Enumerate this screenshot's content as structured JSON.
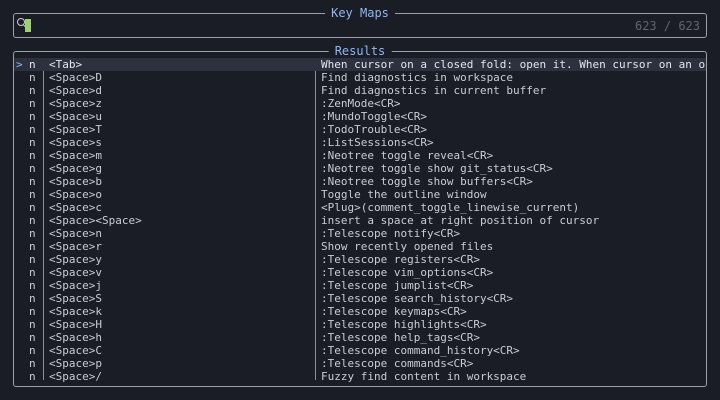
{
  "prompt": {
    "title": "Key Maps",
    "counter": "623 / 623",
    "query": ""
  },
  "results": {
    "title": "Results",
    "selection_caret": ">",
    "rows": [
      {
        "mode": "n",
        "key": "<Tab>",
        "desc": "When cursor on a closed fold: open it. When cursor on an op"
      },
      {
        "mode": "n",
        "key": "<Space>D",
        "desc": "Find diagnostics in workspace"
      },
      {
        "mode": "n",
        "key": "<Space>d",
        "desc": "Find diagnostics in current buffer"
      },
      {
        "mode": "n",
        "key": "<Space>z",
        "desc": ":ZenMode<CR>"
      },
      {
        "mode": "n",
        "key": "<Space>u",
        "desc": ":MundoToggle<CR>"
      },
      {
        "mode": "n",
        "key": "<Space>T",
        "desc": ":TodoTrouble<CR>"
      },
      {
        "mode": "n",
        "key": "<Space>s",
        "desc": ":ListSessions<CR>"
      },
      {
        "mode": "n",
        "key": "<Space>m",
        "desc": ":Neotree toggle reveal<CR>"
      },
      {
        "mode": "n",
        "key": "<Space>g",
        "desc": ":Neotree toggle show git_status<CR>"
      },
      {
        "mode": "n",
        "key": "<Space>b",
        "desc": ":Neotree toggle show buffers<CR>"
      },
      {
        "mode": "n",
        "key": "<Space>o",
        "desc": "Toggle the outline window"
      },
      {
        "mode": "n",
        "key": "<Space>c",
        "desc": "<Plug>(comment_toggle_linewise_current)"
      },
      {
        "mode": "n",
        "key": "<Space><Space>",
        "desc": "insert a space at right position of cursor"
      },
      {
        "mode": "n",
        "key": "<Space>n",
        "desc": ":Telescope notify<CR>"
      },
      {
        "mode": "n",
        "key": "<Space>r",
        "desc": "Show recently opened files"
      },
      {
        "mode": "n",
        "key": "<Space>y",
        "desc": ":Telescope registers<CR>"
      },
      {
        "mode": "n",
        "key": "<Space>v",
        "desc": ":Telescope vim_options<CR>"
      },
      {
        "mode": "n",
        "key": "<Space>j",
        "desc": ":Telescope jumplist<CR>"
      },
      {
        "mode": "n",
        "key": "<Space>S",
        "desc": ":Telescope search_history<CR>"
      },
      {
        "mode": "n",
        "key": "<Space>k",
        "desc": ":Telescope keymaps<CR>"
      },
      {
        "mode": "n",
        "key": "<Space>H",
        "desc": ":Telescope highlights<CR>"
      },
      {
        "mode": "n",
        "key": "<Space>h",
        "desc": ":Telescope help_tags<CR>"
      },
      {
        "mode": "n",
        "key": "<Space>C",
        "desc": ":Telescope command_history<CR>"
      },
      {
        "mode": "n",
        "key": "<Space>p",
        "desc": ":Telescope commands<CR>"
      },
      {
        "mode": "n",
        "key": "<Space>/",
        "desc": "Fuzzy find content in workspace"
      }
    ]
  }
}
